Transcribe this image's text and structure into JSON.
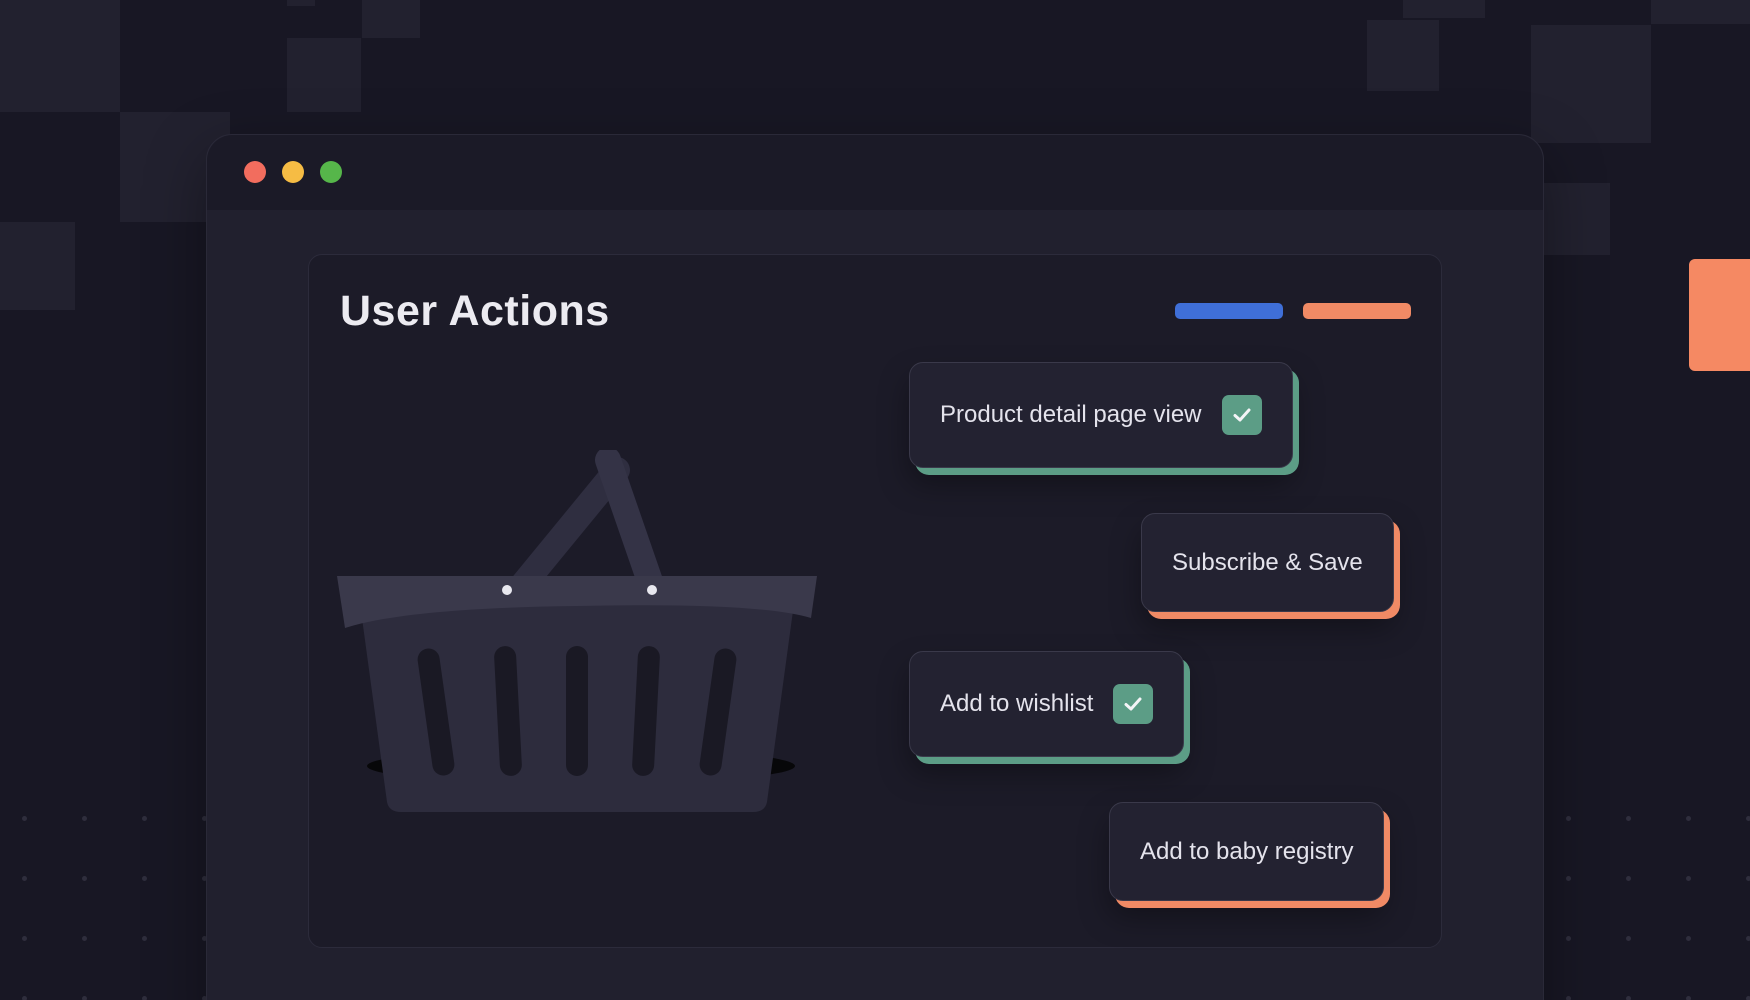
{
  "colors": {
    "background": "#181724",
    "window": "#21202e",
    "panel": "#1c1b28",
    "teal_accent": "#5c9d86",
    "orange_accent": "#f08a65",
    "blue_accent": "#3f6fd8",
    "traffic_red": "#f26d5e",
    "traffic_yellow": "#f6bc44",
    "traffic_green": "#56b64a"
  },
  "window": {
    "controls": [
      "close-dot",
      "minimize-dot",
      "maximize-dot"
    ]
  },
  "panel": {
    "title": "User Actions",
    "illustration": "shopping-basket-icon"
  },
  "actions": [
    {
      "label": "Product detail page view",
      "checked": true,
      "accent": "teal"
    },
    {
      "label": "Subscribe & Save",
      "checked": false,
      "accent": "orange"
    },
    {
      "label": "Add to wishlist",
      "checked": true,
      "accent": "teal"
    },
    {
      "label": "Add to baby registry",
      "checked": false,
      "accent": "orange"
    }
  ]
}
